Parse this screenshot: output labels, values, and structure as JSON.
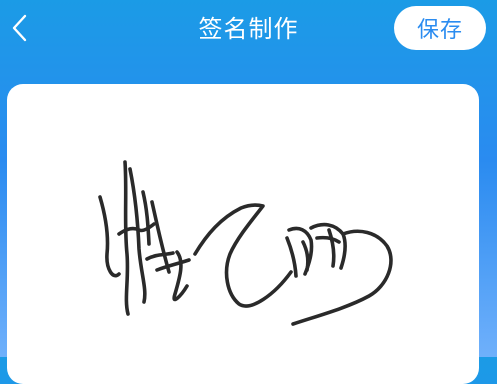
{
  "header": {
    "title": "签名制作",
    "save_label": "保存"
  },
  "icons": {
    "back": "chevron-left-icon"
  },
  "colors": {
    "bg_top": "#1b9be6",
    "bg_mid": "#2a8bf0",
    "bg_bottom": "#6fb0fb",
    "accent": "#2b8cf0",
    "ink": "#2a2a2a",
    "canvas": "#ffffff"
  }
}
